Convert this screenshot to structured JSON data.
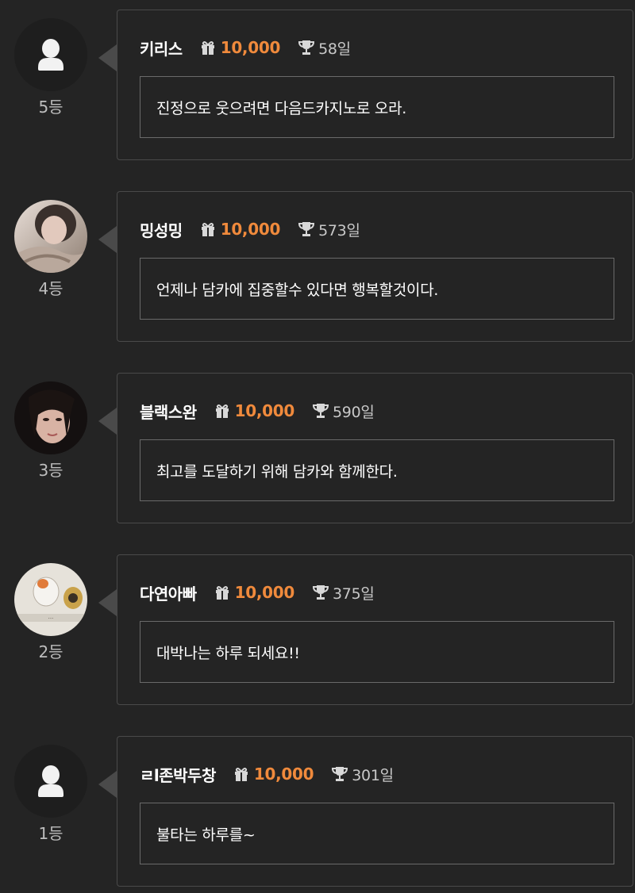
{
  "accent_color": "#f08a3c",
  "entries": [
    {
      "rank_label": "5등",
      "avatar": "default-user-icon",
      "name": "키리스",
      "points": "10,000",
      "days": "58일",
      "message": "진정으로 웃으려면 다음드카지노로 오라."
    },
    {
      "rank_label": "4등",
      "avatar": "photo",
      "name": "밍성밍",
      "points": "10,000",
      "days": "573일",
      "message": "언제나 담카에 집중할수 있다면 행복할것이다."
    },
    {
      "rank_label": "3등",
      "avatar": "photo",
      "name": "블랙스완",
      "points": "10,000",
      "days": "590일",
      "message": "최고를 도달하기 위해 담카와 함께한다."
    },
    {
      "rank_label": "2등",
      "avatar": "photo",
      "name": "다연아빠",
      "points": "10,000",
      "days": "375일",
      "message": "대박나는 하루 되세요!!"
    },
    {
      "rank_label": "1등",
      "avatar": "default-user-icon",
      "name": "ㄹl존박두창",
      "points": "10,000",
      "days": "301일",
      "message": "불타는 하루를~"
    }
  ]
}
